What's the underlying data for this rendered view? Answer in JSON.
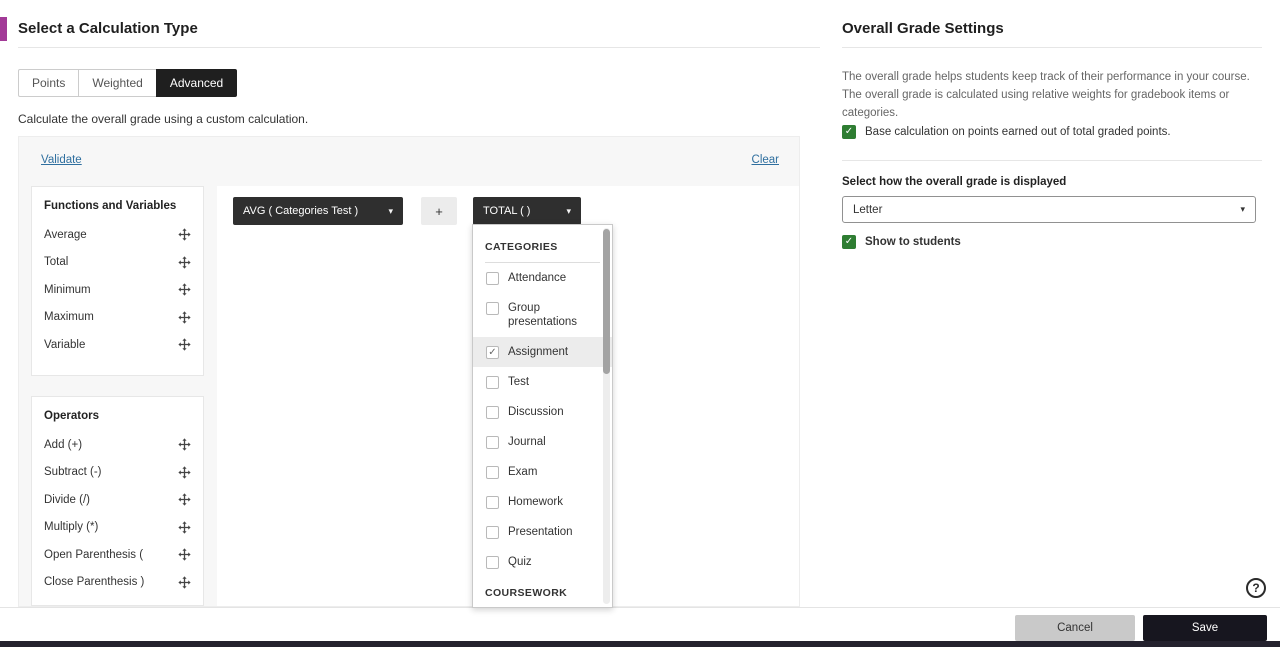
{
  "header": {
    "title": "Select a Calculation Type"
  },
  "tabs": {
    "items": [
      "Points",
      "Weighted",
      "Advanced"
    ],
    "active": "Advanced"
  },
  "caption": "Calculate the overall grade using a custom calculation.",
  "formula_panel": {
    "validate_label": "Validate",
    "clear_label": "Clear"
  },
  "functions_panel": {
    "title": "Functions and Variables",
    "items": [
      "Average",
      "Total",
      "Minimum",
      "Maximum",
      "Variable"
    ]
  },
  "operators_panel": {
    "title": "Operators",
    "items": [
      "Add (+)",
      "Subtract (-)",
      "Divide (/)",
      "Multiply (*)",
      "Open Parenthesis (",
      "Close Parenthesis )"
    ]
  },
  "formula": {
    "avg_chip": "AVG ( Categories Test )",
    "plus_chip": "+",
    "total_chip": "TOTAL ( )"
  },
  "dropdown": {
    "categories_header": "CATEGORIES",
    "categories": [
      {
        "label": "Attendance",
        "checked": false
      },
      {
        "label": "Group presentations",
        "checked": false
      },
      {
        "label": "Assignment",
        "checked": true
      },
      {
        "label": "Test",
        "checked": false
      },
      {
        "label": "Discussion",
        "checked": false
      },
      {
        "label": "Journal",
        "checked": false
      },
      {
        "label": "Exam",
        "checked": false
      },
      {
        "label": "Homework",
        "checked": false
      },
      {
        "label": "Presentation",
        "checked": false
      },
      {
        "label": "Quiz",
        "checked": false
      }
    ],
    "coursework_header": "COURSEWORK"
  },
  "settings": {
    "title": "Overall Grade Settings",
    "description": "The overall grade helps students keep track of their performance in your course. The overall grade is calculated using relative weights for gradebook items or categories.",
    "base_calc_label": "Base calculation on points earned out of total graded points.",
    "display_label": "Select how the overall grade is displayed",
    "display_value": "Letter",
    "show_label": "Show to students"
  },
  "footer": {
    "cancel_label": "Cancel",
    "save_label": "Save"
  },
  "icons": {
    "caret": "▾",
    "check": "✓",
    "help": "?"
  },
  "colors": {
    "accent": "#a23a97",
    "green": "#2e7d32",
    "pill": "#2f2f2f",
    "link": "#2f6f9f",
    "footerbar": "#24222e"
  }
}
